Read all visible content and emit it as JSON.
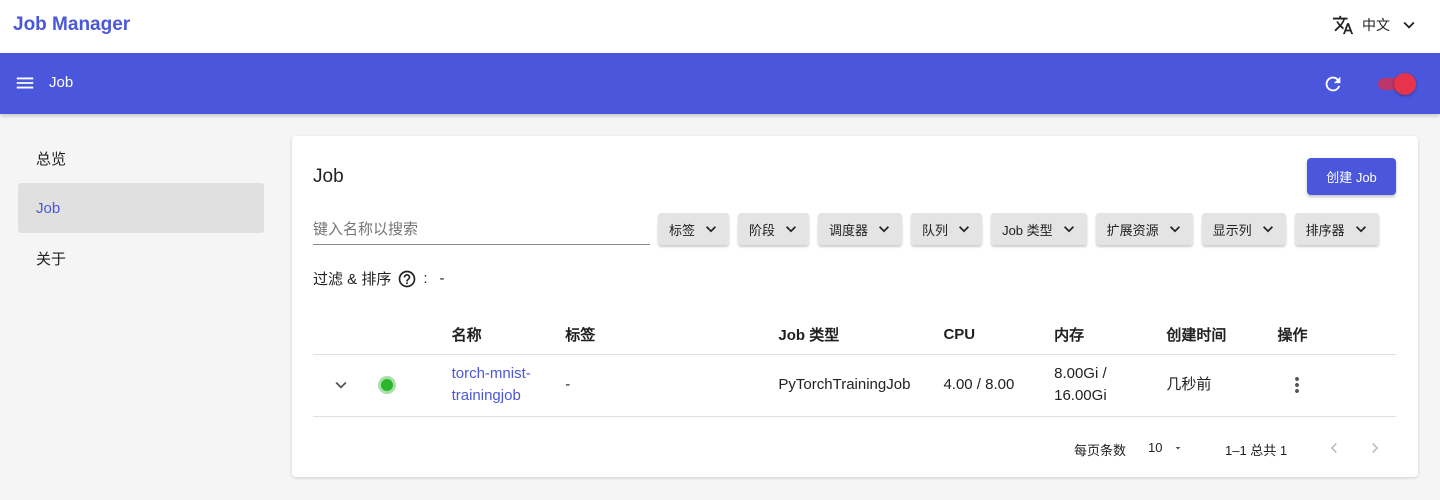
{
  "brand": "Job Manager",
  "language": "中文",
  "appbar": {
    "title": "Job"
  },
  "sidebar": {
    "items": [
      {
        "label": "总览"
      },
      {
        "label": "Job"
      },
      {
        "label": "关于"
      }
    ]
  },
  "main": {
    "title": "Job",
    "create_label": "创建 Job",
    "search_placeholder": "键入名称以搜索",
    "filters": [
      "标签",
      "阶段",
      "调度器",
      "队列",
      "Job 类型",
      "扩展资源",
      "显示列",
      "排序器"
    ],
    "filter_sort_label": "过滤 & 排序",
    "filter_sort_value": "-",
    "columns": [
      "名称",
      "标签",
      "Job 类型",
      "CPU",
      "内存",
      "创建时间",
      "操作"
    ],
    "rows": [
      {
        "name_line1": "torch-mnist-",
        "name_line2": "trainingjob",
        "labels": "-",
        "type": "PyTorchTrainingJob",
        "cpu": "4.00 / 8.00",
        "mem_line1": "8.00Gi /",
        "mem_line2": "16.00Gi",
        "created": "几秒前",
        "status_color": "#2bb52b"
      }
    ],
    "pagination": {
      "rows_per_page_label": "每页条数",
      "rows_per_page": "10",
      "range": "1–1 总共 1"
    }
  },
  "colors": {
    "primary": "#4a57dc",
    "accent_toggle": "#e8334c",
    "status_running": "#2bb52b"
  },
  "icons": [
    "translate-icon",
    "chevron-down-icon",
    "menu-icon",
    "refresh-icon",
    "help-circle-icon",
    "expand-row-icon",
    "more-vert-icon",
    "chevron-left-icon",
    "chevron-right-icon"
  ]
}
